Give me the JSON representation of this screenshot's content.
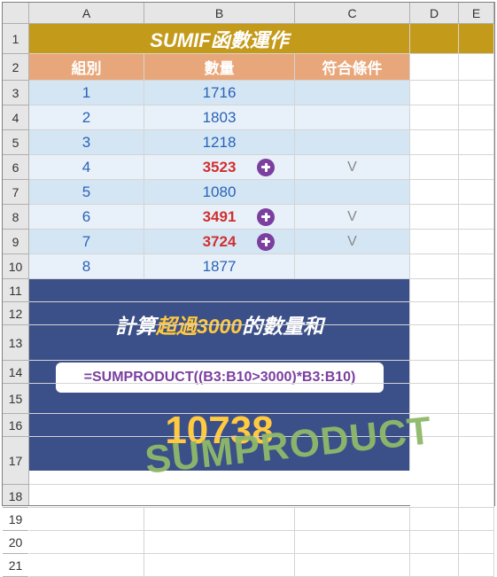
{
  "columns": [
    "A",
    "B",
    "C",
    "D",
    "E"
  ],
  "rows": [
    "1",
    "2",
    "3",
    "4",
    "5",
    "6",
    "7",
    "8",
    "9",
    "10",
    "11",
    "12",
    "13",
    "14",
    "15",
    "16",
    "17",
    "18",
    "19",
    "20",
    "21"
  ],
  "title": "SUMIF函數運作",
  "headers": {
    "group": "組別",
    "qty": "數量",
    "match": "符合條件"
  },
  "data": [
    {
      "group": "1",
      "qty": "1716",
      "over": false,
      "match": ""
    },
    {
      "group": "2",
      "qty": "1803",
      "over": false,
      "match": ""
    },
    {
      "group": "3",
      "qty": "1218",
      "over": false,
      "match": ""
    },
    {
      "group": "4",
      "qty": "3523",
      "over": true,
      "match": "V"
    },
    {
      "group": "5",
      "qty": "1080",
      "over": false,
      "match": ""
    },
    {
      "group": "6",
      "qty": "3491",
      "over": true,
      "match": "V"
    },
    {
      "group": "7",
      "qty": "3724",
      "over": true,
      "match": "V"
    },
    {
      "group": "8",
      "qty": "1877",
      "over": false,
      "match": ""
    }
  ],
  "panel": {
    "msg_pre": "計算",
    "msg_hl": "超過3000",
    "msg_post": "的數量和",
    "formula": "=SUMPRODUCT((B3:B10>3000)*B3:B10)",
    "result": "10738"
  },
  "watermark": "SUMPRODUCT",
  "chart_data": {
    "type": "table",
    "title": "SUMIF函數運作",
    "columns": [
      "組別",
      "數量",
      "符合條件"
    ],
    "rows": [
      [
        "1",
        1716,
        ""
      ],
      [
        "2",
        1803,
        ""
      ],
      [
        "3",
        1218,
        ""
      ],
      [
        "4",
        3523,
        "V"
      ],
      [
        "5",
        1080,
        ""
      ],
      [
        "6",
        3491,
        "V"
      ],
      [
        "7",
        3724,
        "V"
      ],
      [
        "8",
        1877,
        ""
      ]
    ],
    "threshold": 3000,
    "sum_over_threshold": 10738,
    "formula": "=SUMPRODUCT((B3:B10>3000)*B3:B10)"
  }
}
